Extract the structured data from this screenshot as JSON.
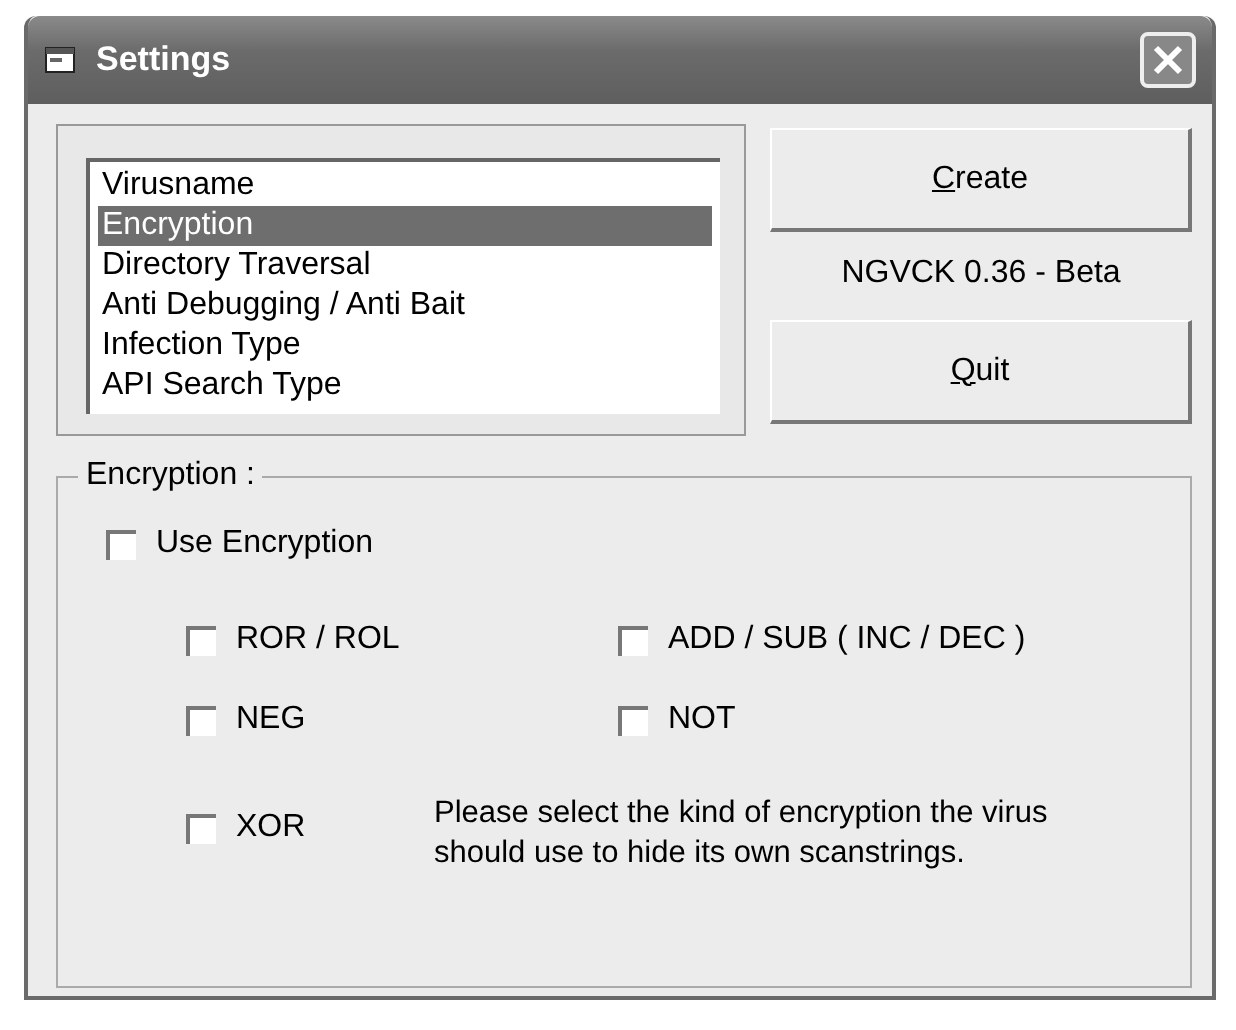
{
  "window": {
    "title": "Settings"
  },
  "list": {
    "items": [
      {
        "label": "Virusname",
        "selected": false
      },
      {
        "label": "Encryption",
        "selected": true
      },
      {
        "label": "Directory Traversal",
        "selected": false
      },
      {
        "label": "Anti Debugging / Anti Bait",
        "selected": false
      },
      {
        "label": "Infection Type",
        "selected": false
      },
      {
        "label": "API Search Type",
        "selected": false
      }
    ]
  },
  "buttons": [
    {
      "label": "Create",
      "underline_first": true
    },
    {
      "label": "Quit",
      "underline_first": true
    }
  ],
  "version": "NGVCK 0.36 - Beta",
  "group": {
    "legend": "Encryption :",
    "main_option": {
      "label": "Use Encryption",
      "checked": false
    },
    "options": [
      {
        "label": "ROR / ROL",
        "checked": false
      },
      {
        "label": "ADD / SUB ( INC / DEC )",
        "checked": false
      },
      {
        "label": "NEG",
        "checked": false
      },
      {
        "label": "NOT",
        "checked": false
      },
      {
        "label": "XOR",
        "checked": false
      }
    ],
    "hint": "Please select the kind of encryption the virus should use to hide its own scanstrings."
  }
}
